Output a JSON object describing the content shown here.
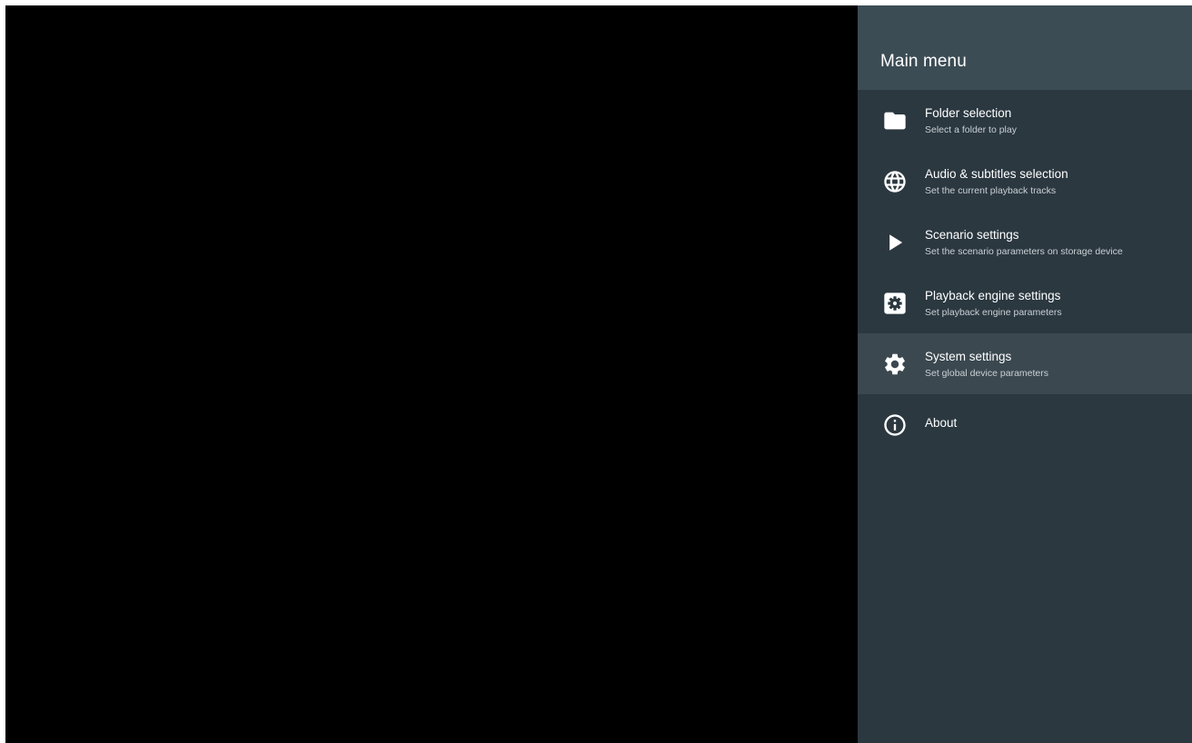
{
  "main_menu": {
    "title": "Main menu",
    "items": [
      {
        "label": "Folder selection",
        "sublabel": "Select a folder to play",
        "icon": "folder-icon"
      },
      {
        "label": "Audio & subtitles selection",
        "sublabel": "Set the current playback tracks",
        "icon": "globe-icon"
      },
      {
        "label": "Scenario settings",
        "sublabel": "Set the scenario parameters on storage device",
        "icon": "play-icon"
      },
      {
        "label": "Playback engine settings",
        "sublabel": "Set playback engine parameters",
        "icon": "engine-settings-icon"
      },
      {
        "label": "System settings",
        "sublabel": "Set global device parameters",
        "icon": "gear-icon",
        "selected": true
      },
      {
        "label": "About",
        "icon": "info-icon"
      }
    ]
  },
  "colors": {
    "panel_background": "#2b3840",
    "header_background": "#3c4c55",
    "selected_background": "#3b4850",
    "video_background": "#000000"
  }
}
